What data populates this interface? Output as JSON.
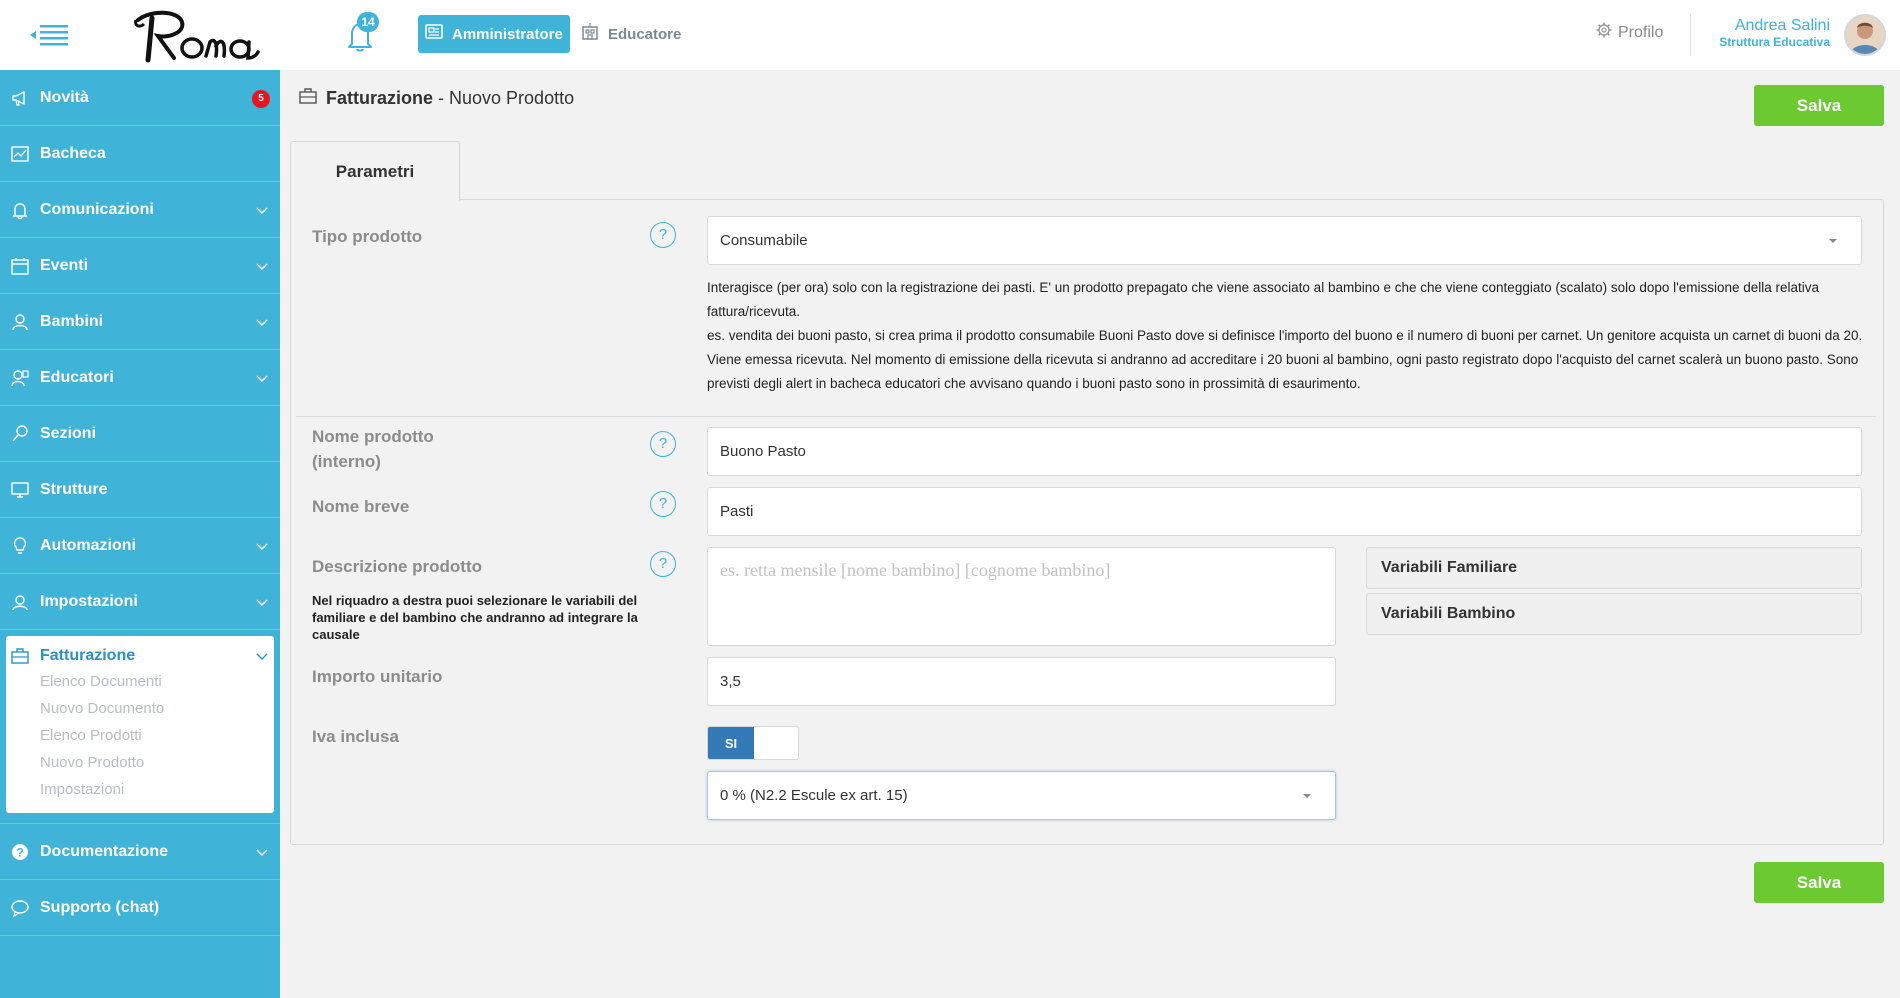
{
  "header": {
    "logo_text": "Roma",
    "notifications_count": "14",
    "role_admin": "Amministratore",
    "role_educator": "Educatore",
    "profile_label": "Profilo",
    "user_name": "Andrea Salini",
    "user_role": "Struttura Educativa"
  },
  "sidebar": {
    "items": [
      {
        "label": "Novità",
        "icon": "megaphone-icon",
        "badge": "5"
      },
      {
        "label": "Bacheca",
        "icon": "board-icon"
      },
      {
        "label": "Comunicazioni",
        "icon": "bell-icon"
      },
      {
        "label": "Eventi",
        "icon": "calendar-icon"
      },
      {
        "label": "Bambini",
        "icon": "child-icon"
      },
      {
        "label": "Educatori",
        "icon": "educator-icon"
      },
      {
        "label": "Sezioni",
        "icon": "sections-icon"
      },
      {
        "label": "Strutture",
        "icon": "monitor-icon"
      },
      {
        "label": "Automazioni",
        "icon": "bulb-icon"
      },
      {
        "label": "Impostazioni",
        "icon": "settings-icon"
      }
    ],
    "active": {
      "label": "Fatturazione",
      "icon": "briefcase-icon",
      "subitems": [
        "Elenco Documenti",
        "Nuovo Documento",
        "Elenco Prodotti",
        "Nuovo Prodotto",
        "Impostazioni"
      ]
    },
    "bottom_items": [
      {
        "label": "Documentazione",
        "icon": "question-circle-icon"
      },
      {
        "label": "Supporto (chat)",
        "icon": "chat-icon"
      }
    ]
  },
  "page": {
    "title_bold": "Fatturazione",
    "title_rest": " - Nuovo Prodotto",
    "save_label": "Salva",
    "tab_label": "Parametri"
  },
  "form": {
    "tipo_prodotto_label": "Tipo prodotto",
    "tipo_prodotto_value": "Consumabile",
    "tipo_desc_1": "Interagisce (per ora) solo con la registrazione dei pasti. E' un prodotto prepagato che viene associato al bambino e che che viene conteggiato (scalato) solo dopo l'emissione della relativa fattura/ricevuta.",
    "tipo_desc_2": "es. vendita dei buoni pasto, si crea prima il prodotto consumabile Buoni Pasto dove si definisce l'importo del buono e il numero di buoni per carnet. Un genitore acquista un carnet di buoni da 20. Viene emessa ricevuta. Nel momento di emissione della ricevuta si andranno ad accreditare i 20 buoni al bambino, ogni pasto registrato dopo l'acquisto del carnet scalerà un buono pasto. Sono previsti degli alert in bacheca educatori che avvisano quando i buoni pasto sono in prossimità di esaurimento.",
    "nome_prodotto_label": "Nome prodotto (interno)",
    "nome_prodotto_value": "Buono Pasto",
    "nome_breve_label": "Nome breve",
    "nome_breve_value": "Pasti",
    "descrizione_label": "Descrizione prodotto",
    "descrizione_note": "Nel riquadro a destra puoi selezionare le variabili del familiare e del bambino che andranno ad integrare la causale",
    "descrizione_placeholder": "es. retta mensile [nome bambino] [cognome bambino]",
    "variabili_familiare": "Variabili Familiare",
    "variabili_bambino": "Variabili Bambino",
    "importo_label": "Importo unitario",
    "importo_value": "3,5",
    "iva_label": "Iva inclusa",
    "iva_toggle": "SI",
    "iva_rate": "0 % (N2.2 Escule ex art. 15)",
    "help": "?"
  }
}
